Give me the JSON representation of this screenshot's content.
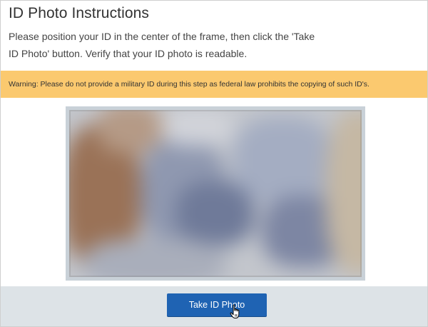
{
  "page": {
    "title": "ID Photo Instructions",
    "instructions": "Please position your ID in the center of the frame, then click the 'Take ID Photo' button. Verify that your ID photo is readable.",
    "warning": "Warning: Please do not provide a military ID during this step as federal law prohibits the copying of such ID's.",
    "take_photo_label": "Take ID Photo"
  },
  "colors": {
    "warning_bg": "#fbc96f",
    "button_bg": "#1f63b3",
    "toolbar_bg": "#dde3e7"
  },
  "icons": {
    "cursor": "hand-pointer-icon"
  }
}
